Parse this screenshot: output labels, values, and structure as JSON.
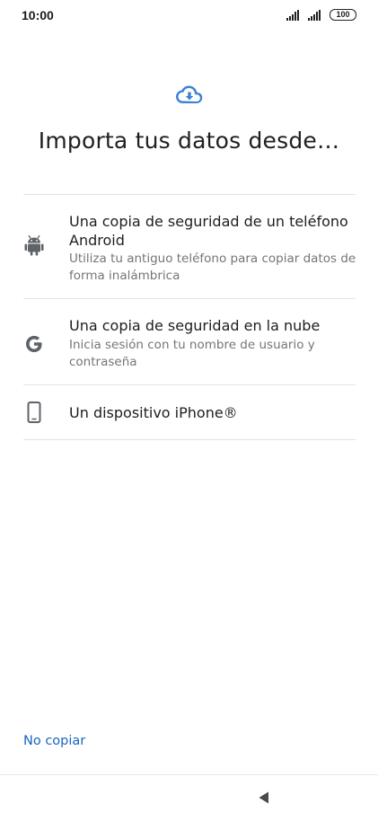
{
  "status_bar": {
    "time": "10:00",
    "battery": "100"
  },
  "header": {
    "icon": "cloud-download-icon",
    "title": "Importa tus datos desde…"
  },
  "options": [
    {
      "icon": "android-icon",
      "title": "Una copia de seguridad de un teléfono Android",
      "subtitle": "Utiliza tu antiguo teléfono para copiar datos de forma inalámbrica"
    },
    {
      "icon": "google-icon",
      "title": "Una copia de seguridad en la nube",
      "subtitle": "Inicia sesión con tu nombre de usuario y contraseña"
    },
    {
      "icon": "phone-icon",
      "title": "Un dispositivo iPhone®"
    }
  ],
  "footer": {
    "skip_label": "No copiar"
  },
  "colors": {
    "accent": "#1565c0",
    "cloud": "#3b82d6",
    "icon_gray": "#5f6368"
  }
}
